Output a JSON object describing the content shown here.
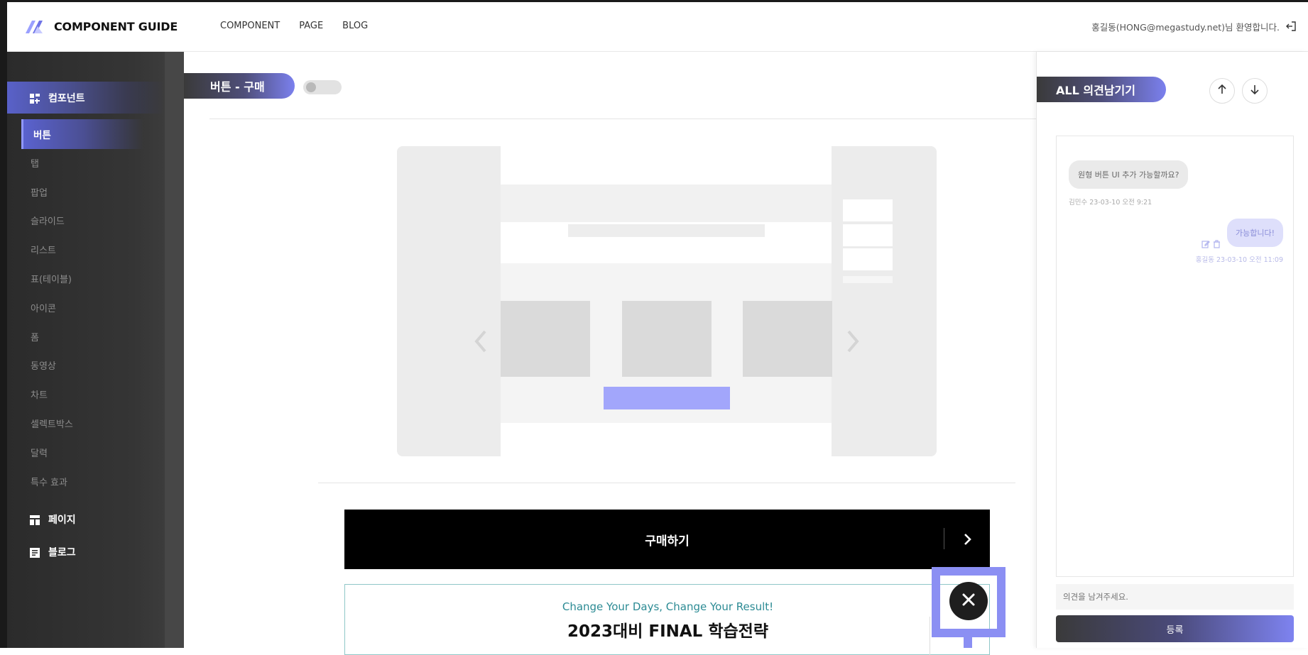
{
  "header": {
    "logo_text": "COMPONENT GUIDE",
    "nav": [
      "COMPONENT",
      "PAGE",
      "BLOG"
    ],
    "user_greeting": "홍길동(HONG@megastudy.net)님 환영합니다."
  },
  "sidebar": {
    "section_component": "컴포넌트",
    "items": [
      "버튼",
      "탭",
      "팝업",
      "슬라이드",
      "리스트",
      "표(테이블)",
      "아이콘",
      "폼",
      "동영상",
      "차트",
      "셀렉트박스",
      "달력",
      "특수 효과"
    ],
    "section_page": "페이지",
    "section_blog": "블로그"
  },
  "main": {
    "title": "버튼 - 구매",
    "buy_label": "구매하기",
    "promo_eng": "Change Your Days, Change Your Result!",
    "promo_kor": "2023대비 FINAL 학습전략"
  },
  "comments": {
    "title": "ALL 의견남기기",
    "messages": [
      {
        "text": "원형 버튼 UI 추가 가능할까요?",
        "meta": "김민수 23-03-10 오전 9:21"
      },
      {
        "text": "가능합니다!",
        "meta": "홍길동 23-03-10 오전 11:09"
      }
    ],
    "input_placeholder": "의견을 남겨주세요.",
    "submit_label": "등록"
  },
  "colors": {
    "accent": "#7b80ee",
    "sidebar_bg": "#2b2b2b",
    "wireframe_button": "#a2a6fb"
  }
}
